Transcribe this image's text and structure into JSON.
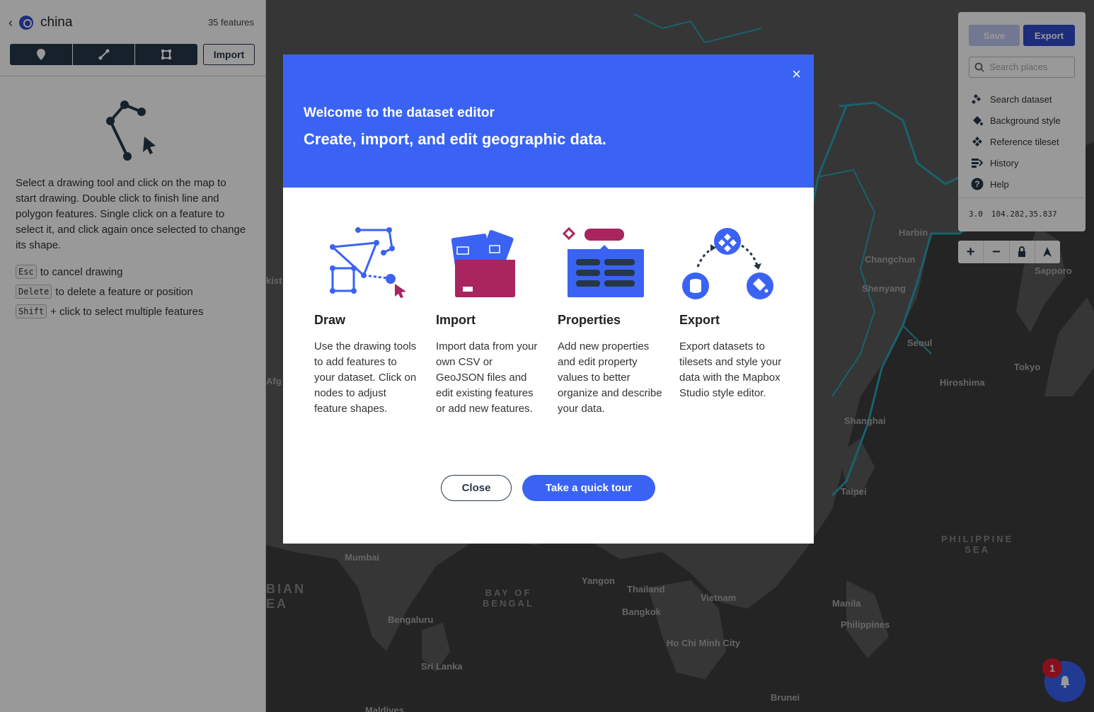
{
  "sidebar": {
    "back": "‹",
    "dataset_name": "china",
    "feature_count": "35 features",
    "import_label": "Import",
    "instructions": "Select a drawing tool and click on the map to start drawing. Double click to finish line and polygon features. Single click on a feature to select it, and click again once selected to change its shape.",
    "hints": [
      {
        "key": "Esc",
        "text": "to cancel drawing"
      },
      {
        "key": "Delete",
        "text": "to delete a feature or position"
      },
      {
        "key": "Shift",
        "text": "+ click to select multiple features"
      }
    ]
  },
  "panel": {
    "save": "Save",
    "export": "Export",
    "search_placeholder": "Search places",
    "menu": [
      {
        "label": "Search dataset",
        "icon": "search-dataset-icon"
      },
      {
        "label": "Background style",
        "icon": "paint-bucket-icon"
      },
      {
        "label": "Reference tileset",
        "icon": "tileset-icon"
      },
      {
        "label": "History",
        "icon": "history-icon"
      },
      {
        "label": "Help",
        "icon": "help-icon"
      }
    ],
    "zoom": "3.0",
    "coords": "104.282,35.837"
  },
  "map_labels": [
    {
      "text": "Harbin"
    },
    {
      "text": "Changchun"
    },
    {
      "text": "Shenyang"
    },
    {
      "text": "Sapporo"
    },
    {
      "text": "Seoul"
    },
    {
      "text": "Tokyo"
    },
    {
      "text": "Hiroshima"
    },
    {
      "text": "Shanghai"
    },
    {
      "text": "Taipei"
    },
    {
      "text": "Mumbai"
    },
    {
      "text": "Yangon"
    },
    {
      "text": "Thailand"
    },
    {
      "text": "Vietnam"
    },
    {
      "text": "Bangkok"
    },
    {
      "text": "Manila"
    },
    {
      "text": "Philippines"
    },
    {
      "text": "Bengaluru"
    },
    {
      "text": "Ho Chi Minh City"
    },
    {
      "text": "Sri Lanka"
    },
    {
      "text": "Brunei"
    },
    {
      "text": "Afg"
    },
    {
      "text": "kist"
    },
    {
      "text": "Maldives"
    }
  ],
  "sea_labels": [
    {
      "text": "BAY OF\nBENGAL"
    },
    {
      "text": "PHILIPPINE\nSEA"
    },
    {
      "text": "BIAN\nEA"
    }
  ],
  "modal": {
    "title": "Welcome to the dataset editor",
    "subtitle": "Create, import, and edit geographic data.",
    "close_icon": "×",
    "features": [
      {
        "title": "Draw",
        "text": "Use the drawing tools to add features to your dataset. Click on nodes to adjust feature shapes."
      },
      {
        "title": "Import",
        "text": "Import data from your own CSV or GeoJSON files and edit existing features or add new features."
      },
      {
        "title": "Properties",
        "text": "Add new properties and edit property values to better organize and describe your data."
      },
      {
        "title": "Export",
        "text": "Export datasets to tilesets and style your data with the Mapbox Studio style editor."
      }
    ],
    "close_label": "Close",
    "tour_label": "Take a quick tour"
  },
  "notification": {
    "count": "1"
  },
  "colors": {
    "accent": "#3a63f4",
    "brand_dark": "#27374a",
    "alert": "#e01b2e",
    "map_bg": "#3d3d3d",
    "border_cyan": "#2aa3b8"
  }
}
